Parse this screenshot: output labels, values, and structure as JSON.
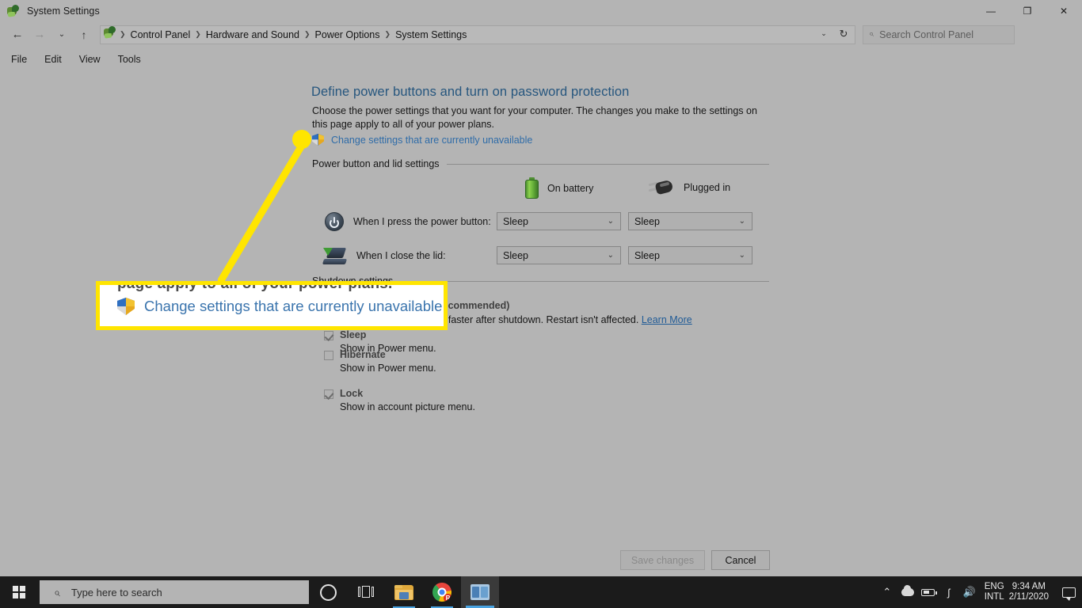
{
  "window": {
    "title": "System Settings",
    "icon": "control-panel-icon",
    "controls": {
      "minimize": "—",
      "maximize": "❐",
      "close": "✕"
    }
  },
  "nav": {
    "back": "←",
    "forward": "→",
    "recent": "⌄",
    "up": "↑",
    "breadcrumbs": [
      "Control Panel",
      "Hardware and Sound",
      "Power Options",
      "System Settings"
    ],
    "separator": "❯",
    "dropdown": "⌄",
    "refresh": "↻"
  },
  "search": {
    "placeholder": "Search Control Panel",
    "icon": "search-icon",
    "glyph": "⌕"
  },
  "menu": {
    "items": [
      "File",
      "Edit",
      "View",
      "Tools"
    ]
  },
  "page": {
    "title": "Define power buttons and turn on password protection",
    "description": "Choose the power settings that you want for your computer. The changes you make to the settings on this page apply to all of your power plans.",
    "uac_link": "Change settings that are currently unavailable"
  },
  "power_section": {
    "group_label": "Power button and lid settings",
    "columns": [
      {
        "label": "On battery",
        "icon": "battery-icon"
      },
      {
        "label": "Plugged in",
        "icon": "power-plug-icon"
      }
    ],
    "rows": [
      {
        "icon": "power-button-icon",
        "label": "When I press the power button:",
        "on_battery": "Sleep",
        "plugged_in": "Sleep"
      },
      {
        "icon": "laptop-lid-icon",
        "label": "When I close the lid:",
        "on_battery": "Sleep",
        "plugged_in": "Sleep"
      }
    ],
    "dropdown_arrow": "⌄"
  },
  "shutdown_section": {
    "group_label": "Shutdown settings",
    "fast_startup": {
      "label": "Turn on fast startup (recommended)",
      "description": "This helps start your PC faster after shutdown. Restart isn't affected.",
      "learn_more": "Learn More",
      "checked": true
    },
    "options": [
      {
        "label": "Sleep",
        "description": "Show in Power menu.",
        "checked": true
      },
      {
        "label": "Hibernate",
        "description": "Show in Power menu.",
        "checked": false
      },
      {
        "label": "Lock",
        "description": "Show in account picture menu.",
        "checked": true
      }
    ]
  },
  "footer": {
    "save_label": "Save changes",
    "cancel_label": "Cancel",
    "save_disabled": true
  },
  "callout": {
    "ghost_text": "page apply to all of your power plans.",
    "text": "Change settings that are currently unavailable",
    "shield_icon": "shield-icon",
    "border_color": "#ffe500"
  },
  "taskbar": {
    "start_icon": "windows-logo-icon",
    "search_placeholder": "Type here to search",
    "search_icon": "search-icon",
    "search_glyph": "⌕",
    "buttons": [
      {
        "name": "cortana-icon"
      },
      {
        "name": "task-view-icon"
      },
      {
        "name": "file-explorer-icon"
      },
      {
        "name": "chrome-icon",
        "badge": "R"
      },
      {
        "name": "control-panel-icon"
      }
    ],
    "tray": {
      "chevron": "⌃",
      "onedrive_icon": "cloud-icon",
      "battery_icon": "battery-icon",
      "network_icon": "wifi-icon",
      "network_glyph": "ʃ",
      "volume_icon": "speaker-icon",
      "volume_glyph": "🔊",
      "language_line1": "ENG",
      "language_line2": "INTL",
      "time": "9:34 AM",
      "date": "2/11/2020",
      "action_center_icon": "notification-icon"
    }
  }
}
